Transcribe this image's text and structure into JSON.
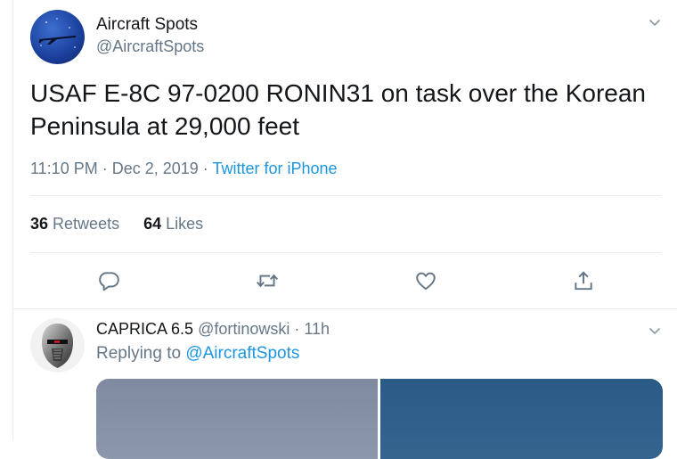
{
  "tweet": {
    "author_name": "Aircraft Spots",
    "author_handle": "@AircraftSpots",
    "text": "USAF E-8C 97-0200 RONIN31 on task over the Korean Peninsula at 29,000 feet",
    "time": "11:10 PM",
    "dot1": " · ",
    "date": "Dec 2, 2019",
    "dot2": " · ",
    "source": "Twitter for iPhone",
    "retweets_count": "36",
    "retweets_label": "Retweets",
    "likes_count": "64",
    "likes_label": "Likes"
  },
  "reply": {
    "author_name": "CAPRICA 6.5",
    "author_handle": "@fortinowski",
    "dot": " · ",
    "time_ago": "11h",
    "replying_prefix": "Replying to ",
    "replying_to": "@AircraftSpots"
  },
  "icons": {
    "reply": "speech-bubble-icon",
    "retweet": "retweet-icon",
    "like": "heart-icon",
    "share": "share-icon",
    "menu": "chevron-down-icon"
  },
  "colors": {
    "link": "#1b95e0",
    "muted": "#657786",
    "text": "#14171a"
  }
}
